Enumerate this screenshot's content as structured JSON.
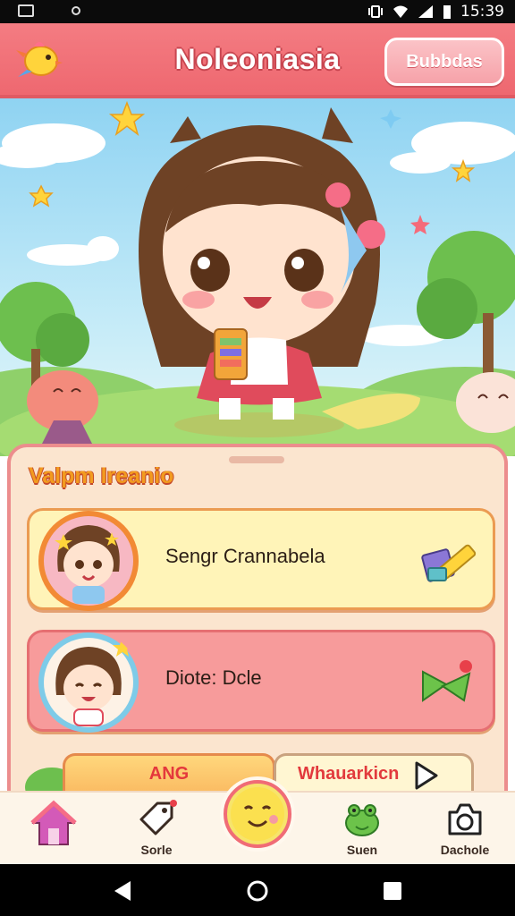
{
  "status_bar": {
    "time": "15:39"
  },
  "header": {
    "title": "Noleoniasia",
    "button_label": "Bubbdas"
  },
  "panel": {
    "title": "Valpm Ireanio",
    "cards": [
      {
        "text": "Sengr Crannabela",
        "icon": "crossed-blocks-icon"
      },
      {
        "text": "Diote: Dcle",
        "icon": "green-arrows-icon"
      }
    ],
    "tabs": [
      {
        "label": "ANG"
      },
      {
        "label": "Whauarkicn"
      }
    ]
  },
  "bottom_nav": {
    "items": [
      {
        "label": "",
        "icon": "home-icon"
      },
      {
        "label": "Sorle",
        "icon": "tag-icon"
      },
      {
        "label": "",
        "icon": "smiley-icon"
      },
      {
        "label": "Suen",
        "icon": "frog-icon"
      },
      {
        "label": "Dachole",
        "icon": "camera-icon"
      }
    ]
  },
  "colors": {
    "header": "#ee6870",
    "panel_bg": "#fbe5cf",
    "card1_bg": "#fff4b8",
    "card2_bg": "#f79b9b",
    "accent_orange": "#f29b1f"
  }
}
